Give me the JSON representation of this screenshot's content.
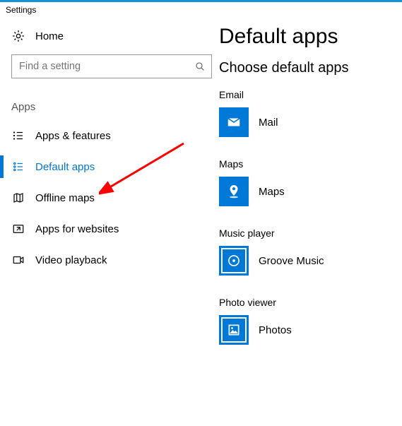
{
  "window": {
    "title": "Settings"
  },
  "home": {
    "label": "Home"
  },
  "search": {
    "placeholder": "Find a setting"
  },
  "nav": {
    "group": "Apps",
    "items": [
      {
        "label": "Apps & features"
      },
      {
        "label": "Default apps"
      },
      {
        "label": "Offline maps"
      },
      {
        "label": "Apps for websites"
      },
      {
        "label": "Video playback"
      }
    ],
    "active_index": 1
  },
  "page": {
    "title": "Default apps",
    "subtitle": "Choose default apps",
    "defaults": [
      {
        "category": "Email",
        "app": "Mail"
      },
      {
        "category": "Maps",
        "app": "Maps"
      },
      {
        "category": "Music player",
        "app": "Groove Music"
      },
      {
        "category": "Photo viewer",
        "app": "Photos"
      }
    ]
  }
}
